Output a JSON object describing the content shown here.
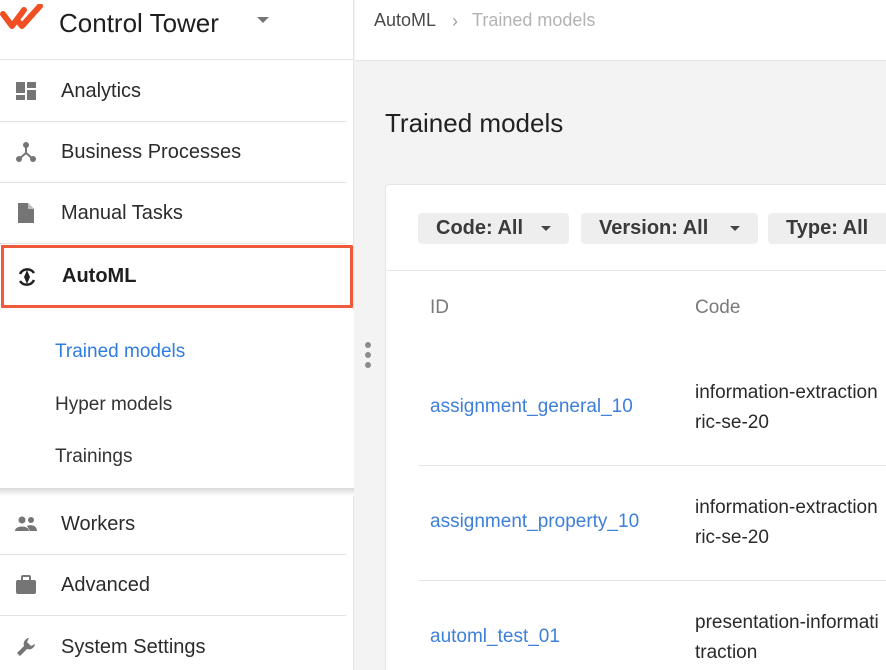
{
  "app": {
    "title": "Control Tower"
  },
  "breadcrumb": {
    "root": "AutoML",
    "separator": "›",
    "current": "Trained models"
  },
  "sidebar": {
    "items": [
      {
        "label": "Analytics",
        "icon": "dashboard-icon"
      },
      {
        "label": "Business Processes",
        "icon": "process-icon"
      },
      {
        "label": "Manual Tasks",
        "icon": "document-icon"
      },
      {
        "label": "AutoML",
        "icon": "automl-icon",
        "active": true
      },
      {
        "label": "Workers",
        "icon": "people-icon"
      },
      {
        "label": "Advanced",
        "icon": "briefcase-icon"
      },
      {
        "label": "System Settings",
        "icon": "wrench-icon"
      }
    ],
    "subitems": [
      {
        "label": "Trained models",
        "current": true
      },
      {
        "label": "Hyper models"
      },
      {
        "label": "Trainings"
      }
    ]
  },
  "main": {
    "title": "Trained models",
    "filters": [
      {
        "label": "Code: All"
      },
      {
        "label": "Version: All"
      },
      {
        "label": "Type: All"
      }
    ],
    "columns": [
      "ID",
      "Code"
    ],
    "rows": [
      {
        "id": "assignment_general_10",
        "code": "information-extraction\nric-se-20"
      },
      {
        "id": "assignment_property_10",
        "code": "information-extraction\nric-se-20"
      },
      {
        "id": "automl_test_01",
        "code": "presentation-informati\ntraction"
      }
    ]
  },
  "colors": {
    "accent": "#2f7de1",
    "highlight": "#ef5a3b",
    "brand": "#f04e23"
  }
}
